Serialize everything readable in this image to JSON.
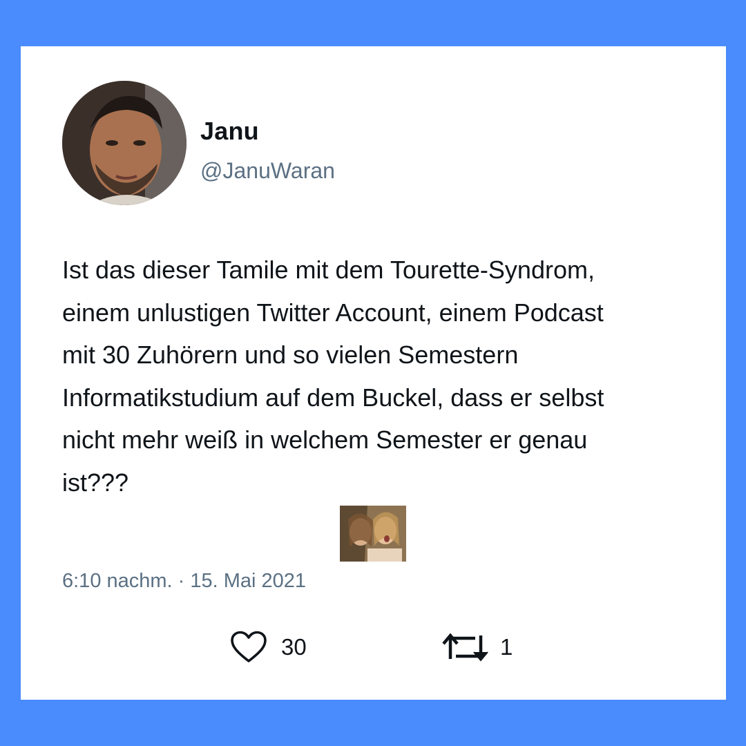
{
  "tweet": {
    "display_name": "Janu",
    "handle": "@JanuWaran",
    "text": "Ist das dieser Tamile mit dem Tourette-Syndrom,\neinem unlustigen Twitter Account, einem Podcast\nmit 30 Zuhörern und so vielen Semestern\nInformatikstudium auf dem Buckel, dass er selbst\nnicht mehr weiß in welchem Semester er genau\nist???",
    "timestamp": "6:10 nachm. · 15. Mai 2021",
    "likes": "30",
    "retweets": "1"
  },
  "icons": {
    "like": "heart-outline-icon",
    "retweet": "retweet-icon"
  },
  "colors": {
    "background": "#4a8cfd",
    "card": "#ffffff",
    "text": "#0f1419",
    "secondary_text": "#5b7083"
  }
}
